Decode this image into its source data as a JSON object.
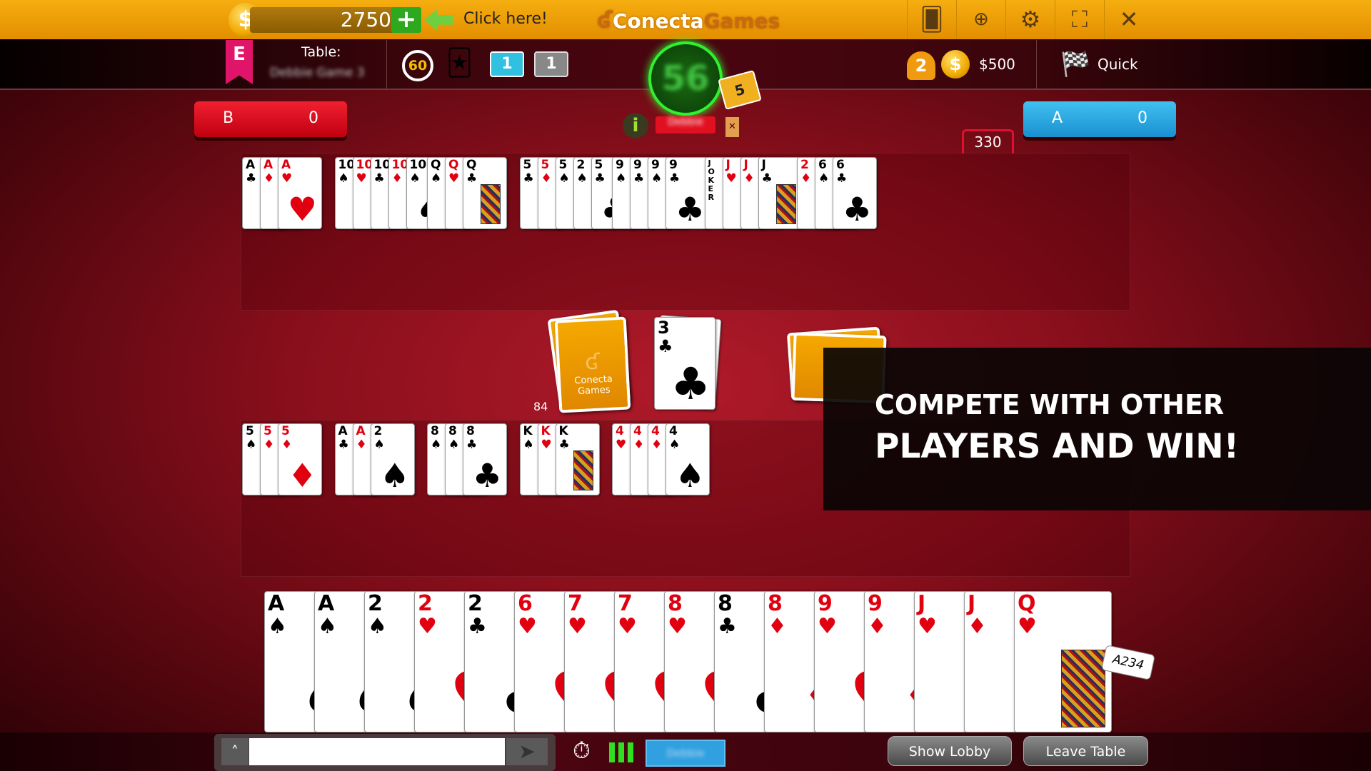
{
  "topbar": {
    "balance": "2750",
    "add_icon": "plus-icon",
    "click_here": "Click here!",
    "logo_a": "Conecta",
    "logo_b": "Games",
    "icons": [
      "cards-icon",
      "uk-flag-icon",
      "gear-icon",
      "fullscreen-icon",
      "close-icon"
    ]
  },
  "infobar": {
    "level_badge": "E",
    "table_label": "Table:",
    "table_name": "Debbie Game 3",
    "timer_seconds": "60",
    "icons": [
      "timer-60-icon",
      "joker-icon",
      "blue-cards-icon",
      "grey-cards-icon"
    ],
    "blue_count": "1",
    "grey_count": "1",
    "players": "2",
    "bet": "$500",
    "mode": "Quick"
  },
  "center": {
    "turn_timer": "56",
    "hand_count": "5",
    "player_name": "Debbie"
  },
  "scores": {
    "team_b": {
      "label": "B",
      "value": "0"
    },
    "team_a": {
      "label": "A",
      "value": "0"
    },
    "tab_points": "330"
  },
  "colors": {
    "topbar": "#f5ae10",
    "team_b": "#e01020",
    "team_a": "#30b0e8",
    "felt": "#8a0f1c"
  },
  "melds_top": [
    [
      [
        "A",
        "♣"
      ],
      [
        "A",
        "♦"
      ],
      [
        "A",
        "♥"
      ]
    ],
    [
      [
        "10",
        "♠"
      ],
      [
        "10",
        "♥"
      ],
      [
        "10",
        "♣"
      ],
      [
        "10",
        "♦"
      ],
      [
        "10",
        "♠"
      ]
    ],
    [
      [
        "Q",
        "♠"
      ],
      [
        "Q",
        "♥"
      ],
      [
        "Q",
        "♣"
      ]
    ],
    [
      [
        "5",
        "♣"
      ],
      [
        "5",
        "♦"
      ],
      [
        "5",
        "♠"
      ],
      [
        "2",
        "♠"
      ],
      [
        "5",
        "♣"
      ]
    ],
    [
      [
        "9",
        "♠"
      ],
      [
        "9",
        "♣"
      ],
      [
        "9",
        "♠"
      ],
      [
        "9",
        "♣"
      ]
    ],
    [
      [
        "JOKER",
        ""
      ],
      [
        "J",
        "♥"
      ],
      [
        "J",
        "♦"
      ],
      [
        "J",
        "♣"
      ]
    ],
    [
      [
        "2",
        "♦"
      ],
      [
        "6",
        "♠"
      ],
      [
        "6",
        "♣"
      ]
    ]
  ],
  "melds_bottom": [
    [
      [
        "5",
        "♠"
      ],
      [
        "5",
        "♦"
      ],
      [
        "5",
        "♦"
      ]
    ],
    [
      [
        "A",
        "♣"
      ],
      [
        "A",
        "♦"
      ],
      [
        "2",
        "♠"
      ]
    ],
    [
      [
        "8",
        "♠"
      ],
      [
        "8",
        "♠"
      ],
      [
        "8",
        "♣"
      ]
    ],
    [
      [
        "K",
        "♠"
      ],
      [
        "K",
        "♥"
      ],
      [
        "K",
        "♣"
      ]
    ],
    [
      [
        "4",
        "♥"
      ],
      [
        "4",
        "♦"
      ],
      [
        "4",
        "♦"
      ],
      [
        "4",
        "♠"
      ]
    ]
  ],
  "deck": {
    "count": "84",
    "logo_a": "Conecta",
    "logo_b": "Games"
  },
  "discard": {
    "rank": "3",
    "suit": "♣"
  },
  "hand": [
    [
      "A",
      "♠"
    ],
    [
      "A",
      "♠"
    ],
    [
      "2",
      "♠"
    ],
    [
      "2",
      "♥"
    ],
    [
      "2",
      "♣"
    ],
    [
      "6",
      "♥"
    ],
    [
      "7",
      "♥"
    ],
    [
      "7",
      "♥"
    ],
    [
      "8",
      "♥"
    ],
    [
      "8",
      "♣"
    ],
    [
      "8",
      "♦"
    ],
    [
      "9",
      "♥"
    ],
    [
      "9",
      "♦"
    ],
    [
      "J",
      "♥"
    ],
    [
      "J",
      "♦"
    ],
    [
      "Q",
      "♥"
    ]
  ],
  "sort_badge": "A234",
  "overlay": {
    "line1": "COMPETE WITH OTHER",
    "line2": "PLAYERS AND WIN!"
  },
  "bottombar": {
    "chat_placeholder": "",
    "show_lobby": "Show Lobby",
    "leave_table": "Leave Table",
    "status_name": "Debbie"
  }
}
